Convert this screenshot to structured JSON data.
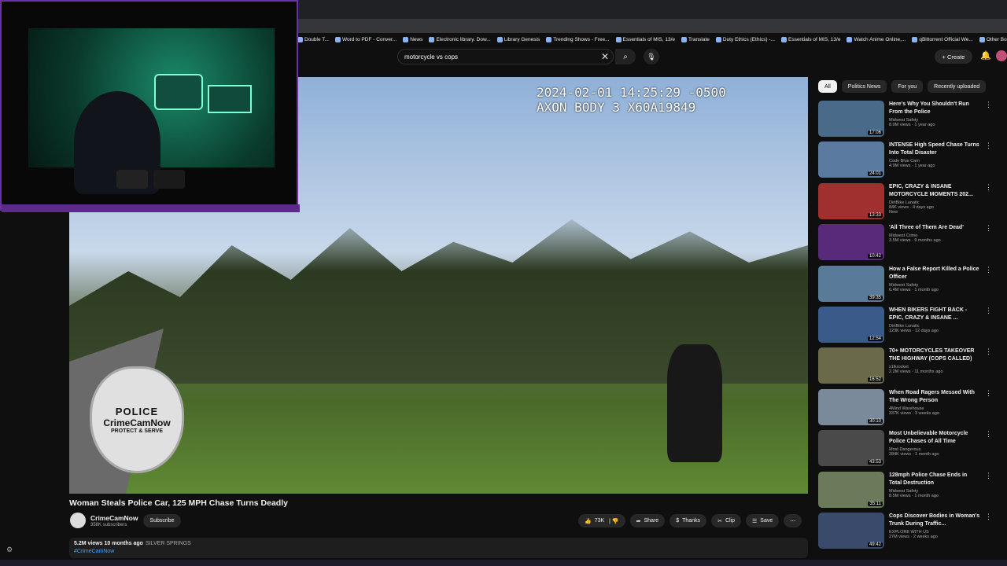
{
  "browser": {
    "bookmarks": [
      "Double T...",
      "Word to PDF - Conver...",
      "News",
      "Electronic library. Dow...",
      "Library Genesis",
      "Trending Shows - Free...",
      "Essentials of MIS, 13/e",
      "Translate",
      "Duty Ethics (Ethics) -...",
      "Essentials of MIS, 13/e",
      "Watch Anime Online,...",
      "qBittorrent Official We...",
      "Other Bo"
    ]
  },
  "youtube": {
    "search_value": "motorcycle vs cops",
    "create_label": "Create",
    "video": {
      "timestamp": "2024-02-01 14:25:29 -0500\nAXON BODY 3 X60A19849",
      "badge_police": "POLICE",
      "badge_name": "CrimeCamNow",
      "badge_motto": "PROTECT & SERVE",
      "title": "Woman Steals Police Car, 125 MPH Chase Turns Deadly"
    },
    "channel": {
      "name": "CrimeCamNow",
      "subs": "358K subscribers",
      "subscribe_label": "Subscribe"
    },
    "actions": {
      "likes": "73K",
      "share": "Share",
      "thanks": "Thanks",
      "clip": "Clip",
      "save": "Save"
    },
    "description": {
      "views": "5.2M views  10 months ago",
      "place": "SILVER SPRINGS",
      "hashtag": "#CrimeCamNow"
    },
    "chips": [
      "All",
      "Politics News",
      "For you",
      "Recently uploaded"
    ],
    "recommendations": [
      {
        "title": "Here's Why You Shouldn't Run From the Police",
        "channel": "Midwest Safety",
        "stats": "8.9M views · 1 year ago",
        "duration": "17:06",
        "color": "#4a6a8a"
      },
      {
        "title": "INTENSE High Speed Chase Turns Into Total Disaster",
        "channel": "Code Blue Cam",
        "stats": "4.9M views · 1 year ago",
        "duration": "24:01",
        "color": "#5a7aa0"
      },
      {
        "title": "EPIC, CRAZY & INSANE MOTORCYCLE MOMENTS 202...",
        "channel": "DirtBike Lunatic",
        "stats": "84K views · 4 days ago",
        "duration": "13:33",
        "color": "#a03030",
        "badge": "New"
      },
      {
        "title": "'All Three of Them Are Dead'",
        "channel": "Midwest Crime",
        "stats": "3.5M views · 9 months ago",
        "duration": "10:42",
        "color": "#5a2a7a"
      },
      {
        "title": "How a False Report Killed a Police Officer",
        "channel": "Midwest Safety",
        "stats": "6.4M views · 1 month ago",
        "duration": "39:35",
        "color": "#5a7a9a"
      },
      {
        "title": "WHEN BIKERS FIGHT BACK - EPIC, CRAZY & INSANE ...",
        "channel": "DirtBike Lunatic",
        "stats": "123K views · 12 days ago",
        "duration": "12:54",
        "color": "#3a5a8a"
      },
      {
        "title": "70+ MOTORCYCLES TAKEOVER THE HIGHWAY (COPS CALLED)",
        "channel": "s1lkrocket",
        "stats": "2.2M views · 11 months ago",
        "duration": "16:52",
        "color": "#6a6a4a"
      },
      {
        "title": "When Road Ragers Messed With The Wrong Person",
        "channel": "4Mind Warehouse",
        "stats": "337K views · 3 weeks ago",
        "duration": "30:10",
        "color": "#7a8a9a"
      },
      {
        "title": "Most Unbelievable Motorcycle Police Chases of All Time",
        "channel": "Most Dangerous",
        "stats": "284K views · 1 month ago",
        "duration": "43:53",
        "color": "#4a4a4a"
      },
      {
        "title": "128mph Police Chase Ends in Total Destruction",
        "channel": "Midwest Safety",
        "stats": "8.5M views · 1 month ago",
        "duration": "35:11",
        "color": "#6a7a5a"
      },
      {
        "title": "Cops Discover Bodies in Woman's Trunk During Traffic...",
        "channel": "EXPLORE WITH US",
        "stats": "27M views · 2 weeks ago",
        "duration": "49:42",
        "color": "#3a4a6a"
      }
    ]
  },
  "colors": {
    "accent": "#3ea6ff",
    "cam_border": "#6b2fa8",
    "notif": "#ff0000"
  }
}
